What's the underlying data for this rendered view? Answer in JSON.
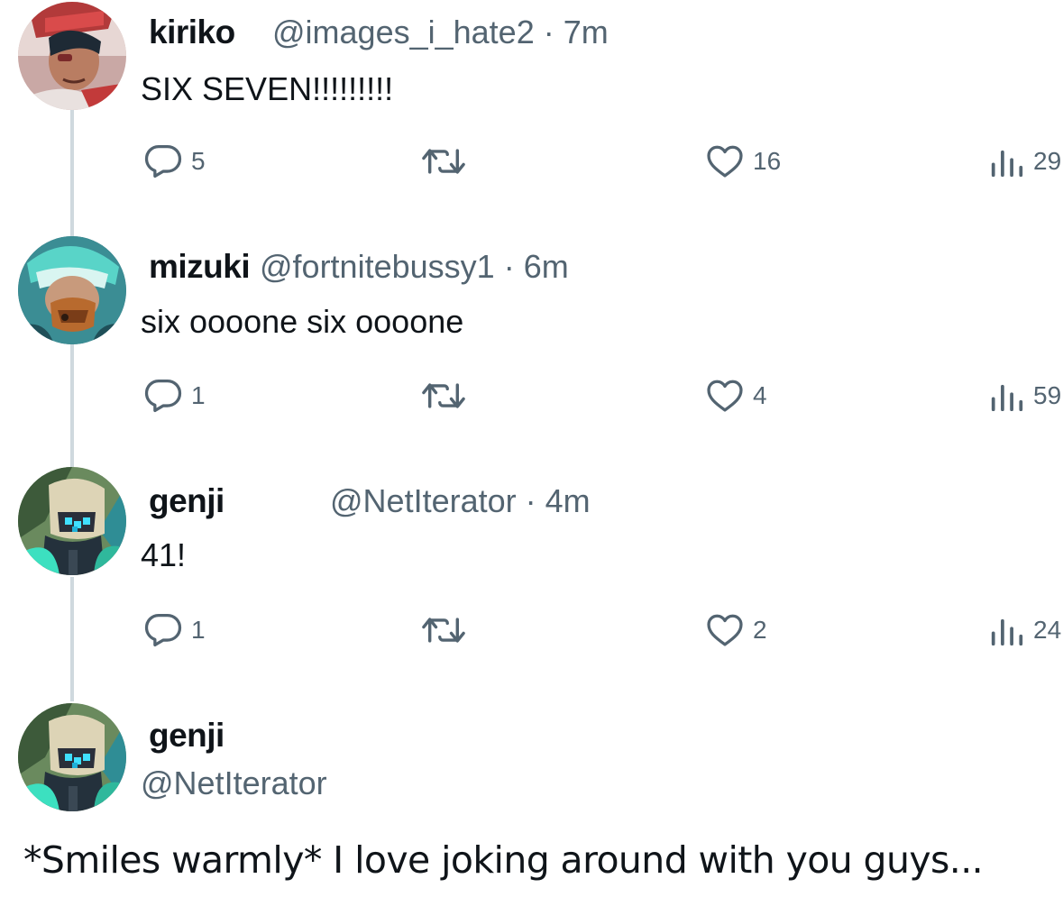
{
  "posts": [
    {
      "name": "kiriko",
      "handle": "@images_i_hate2",
      "time_sep": "·",
      "time": "7m",
      "text": "SIX SEVEN!!!!!!!!!",
      "replies": "5",
      "likes": "16",
      "views": "29"
    },
    {
      "name": "mizuki",
      "handle": "@fortnitebussy1",
      "time_sep": "·",
      "time": "6m",
      "text": "six oooone six oooone",
      "replies": "1",
      "likes": "4",
      "views": "59"
    },
    {
      "name": "genji",
      "handle": "@NetIterator",
      "time_sep": "·",
      "time": "4m",
      "text": "41!",
      "replies": "1",
      "likes": "2",
      "views": "24"
    }
  ],
  "final_post": {
    "name": "genji",
    "handle": "@NetIterator",
    "text": "*Smiles warmly* I love joking around with you guys..."
  },
  "icons": {
    "reply": "reply-icon",
    "retweet": "retweet-icon",
    "like": "heart-icon",
    "views": "views-icon"
  },
  "colors": {
    "text": "#0f1419",
    "secondary": "#536471",
    "thread_line": "#cfd9de"
  }
}
